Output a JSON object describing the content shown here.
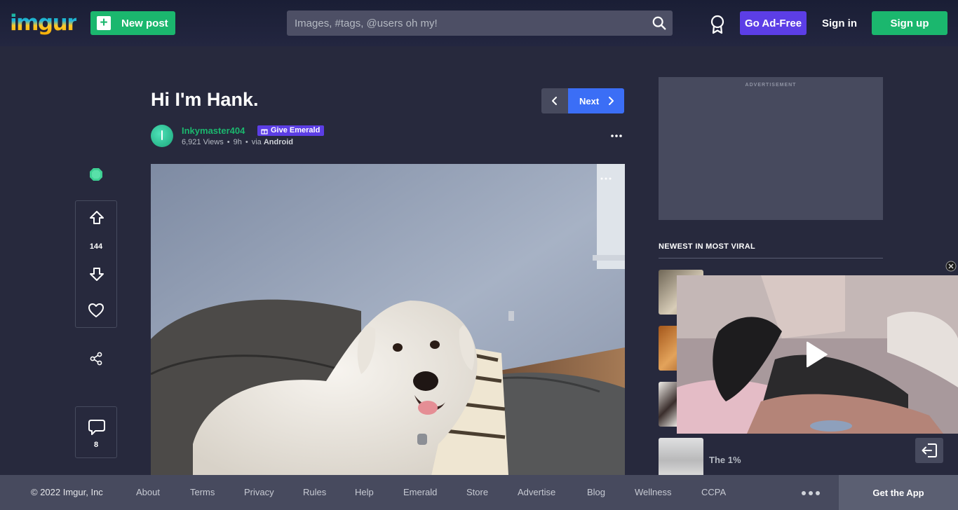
{
  "header": {
    "logo": "imgur",
    "new_post": "New post",
    "search_placeholder": "Images, #tags, @users oh my!",
    "go_ad_free": "Go Ad-Free",
    "sign_in": "Sign in",
    "sign_up": "Sign up"
  },
  "post": {
    "title": "Hi I'm Hank.",
    "next_label": "Next",
    "username": "Inkymaster404",
    "give_emerald": "Give Emerald",
    "views": "6,921 Views",
    "age": "9h",
    "via_prefix": "via",
    "via_source": "Android",
    "upvotes": "144",
    "comments": "8"
  },
  "sidebar": {
    "ad_label": "ADVERTISEMENT",
    "section_title": "NEWEST IN MOST VIRAL",
    "items": [
      {
        "title": ""
      },
      {
        "title": ""
      },
      {
        "title": ""
      },
      {
        "title": "The 1%"
      }
    ]
  },
  "footer": {
    "copyright": "© 2022 Imgur, Inc",
    "links": [
      "About",
      "Terms",
      "Privacy",
      "Rules",
      "Help",
      "Emerald",
      "Store",
      "Advertise",
      "Blog",
      "Wellness",
      "CCPA"
    ],
    "get_app": "Get the App"
  },
  "colors": {
    "background": "#27293d",
    "green": "#1bb76e",
    "purple": "#5c3ee6",
    "blue": "#3b6ef6"
  }
}
